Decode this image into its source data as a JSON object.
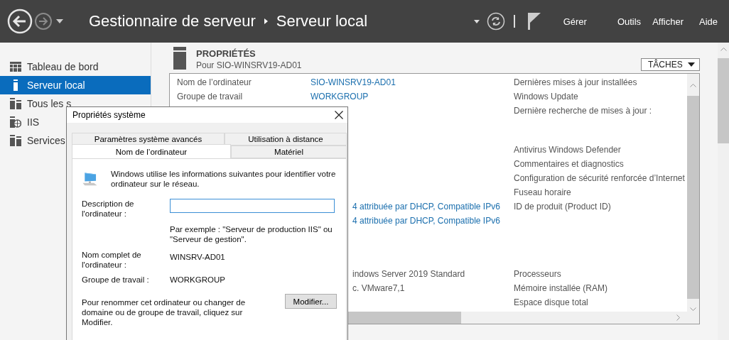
{
  "header": {
    "breadcrumb": [
      "Gestionnaire de serveur",
      "Serveur local"
    ],
    "menu": [
      "Gérer",
      "Outils",
      "Afficher",
      "Aide"
    ]
  },
  "sidebar": {
    "items": [
      {
        "label": "Tableau de bord",
        "selected": false
      },
      {
        "label": "Serveur local",
        "selected": true
      },
      {
        "label": "Tous les s",
        "selected": false
      },
      {
        "label": "IIS",
        "selected": false
      },
      {
        "label": "Services",
        "selected": false
      }
    ]
  },
  "properties": {
    "title": "PROPRIÉTÉS",
    "subtitle": "Pour SIO-WINSRV19-AD01",
    "tasks": "TÂCHES",
    "groups": [
      {
        "rows": [
          {
            "label": "Nom de l’ordinateur",
            "value": "SIO-WINSRV19-AD01",
            "link": true,
            "info": "Dernières mises à jour installées"
          },
          {
            "label": "Groupe de travail",
            "value": "WORKGROUP",
            "link": true,
            "info": "Windows Update"
          },
          {
            "info": "Dernière recherche de mises à jour :"
          }
        ]
      },
      {
        "rows": [
          {
            "info": "Antivirus Windows Defender"
          },
          {
            "info": "Commentaires et diagnostics"
          },
          {
            "info": "Configuration de sécurité renforcée d’Internet"
          },
          {
            "info": "Fuseau horaire"
          },
          {
            "value": "4 attribuée par DHCP, Compatible IPv6",
            "link": true,
            "info": "ID de produit (Product ID)"
          },
          {
            "value": "4 attribuée par DHCP, Compatible IPv6",
            "link": true
          }
        ]
      },
      {
        "rows": [
          {
            "value": "indows Server 2019 Standard",
            "link": false,
            "info": "Processeurs"
          },
          {
            "value": "c. VMware7,1",
            "link": false,
            "info": "Mémoire installée (RAM)"
          },
          {
            "info": "Espace disque total"
          }
        ]
      }
    ]
  },
  "dialog": {
    "title": "Propriétés système",
    "tab_rows": [
      [
        {
          "label": "Paramètres système avancés",
          "selected": false
        },
        {
          "label": "Utilisation à distance",
          "selected": false
        }
      ],
      [
        {
          "label": "Nom de l’ordinateur",
          "selected": true
        },
        {
          "label": "Matériel",
          "selected": false
        }
      ]
    ],
    "intro": "Windows utilise les informations suivantes pour identifier votre ordinateur sur le réseau.",
    "description_label": "Description de l'ordinateur :",
    "example": "Par exemple : \"Serveur de production IIS\" ou \"Serveur de gestion\".",
    "fullname_label": "Nom complet de l'ordinateur :",
    "fullname_value": "WINSRV-AD01",
    "workgroup_label": "Groupe de travail :",
    "workgroup_value": "WORKGROUP",
    "rename_text": "Pour renommer cet ordinateur ou changer de domaine ou de groupe de travail, cliquez sur Modifier.",
    "rename_button": "Modifier..."
  }
}
